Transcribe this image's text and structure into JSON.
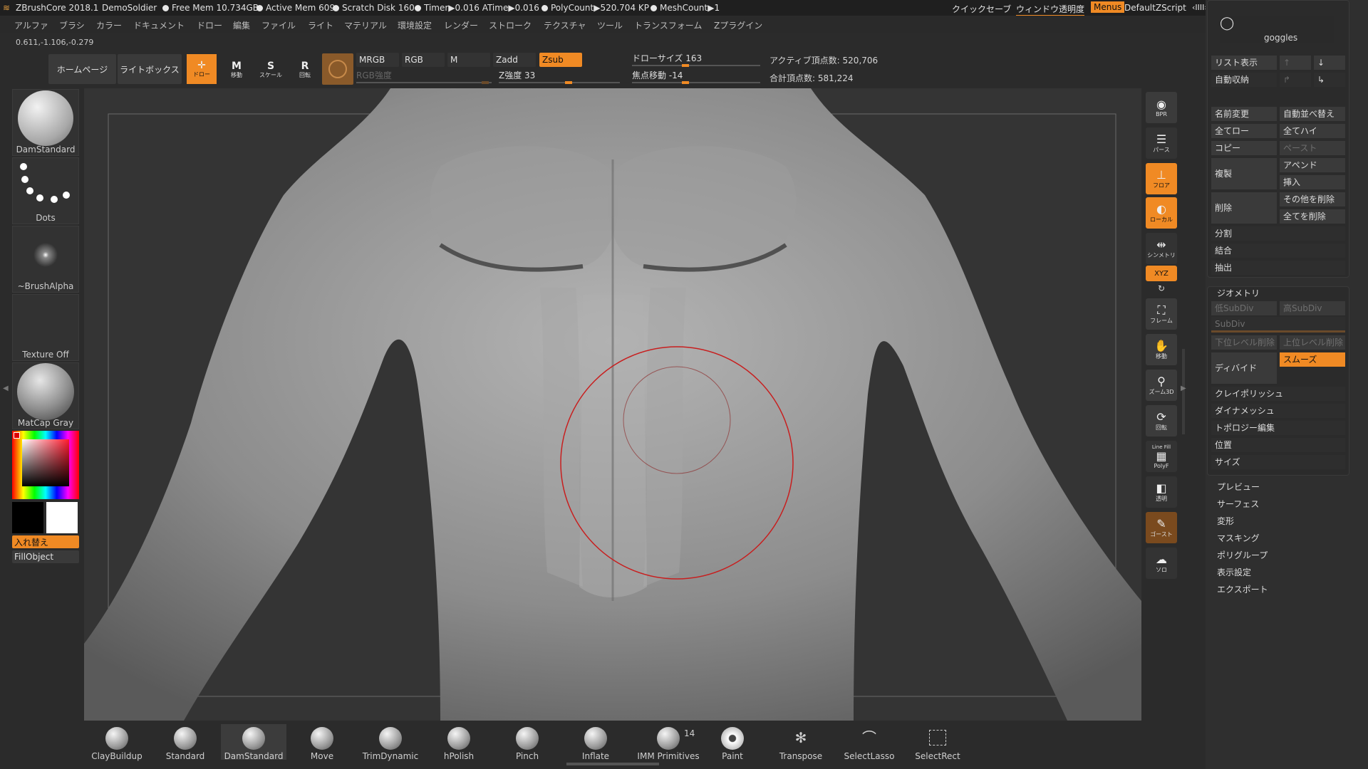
{
  "titlebar": {
    "app": "ZBrushCore 2018.1",
    "doc": "DemoSoldier",
    "free_mem": "Free Mem 10.734GB",
    "active_mem": "Active Mem 609",
    "scratch": "Scratch Disk 160",
    "timer": "Timer▶0.016 ATime▶0.016",
    "polycount": "PolyCount▶520.704 KP",
    "meshcount": "MeshCount▶1",
    "quicksave": "クイックセーブ",
    "transparency": "ウィンドウ透明度",
    "menus": "Menus",
    "script": "DefaultZScript"
  },
  "menu": [
    "アルファ",
    "ブラシ",
    "カラー",
    "ドキュメント",
    "ドロー",
    "編集",
    "ファイル",
    "ライト",
    "マテリアル",
    "環境設定",
    "レンダー",
    "ストローク",
    "テクスチャ",
    "ツール",
    "トランスフォーム",
    "Zプラグイン"
  ],
  "coords": "0.611,-1.106,-0.279",
  "shelf": {
    "home": "ホームページ",
    "lightbox": "ライトボックス",
    "draw": "ドロー",
    "move": "移動",
    "scale": "スケール",
    "rotate": "回転",
    "mrgb": "MRGB",
    "rgb": "RGB",
    "m": "M",
    "zadd": "Zadd",
    "zsub": "Zsub",
    "rgb_intensity": "RGB強度",
    "z_intensity": "Z強度 33",
    "draw_size": "ドローサイズ 163",
    "focal_shift": "焦点移動 -14",
    "active_points": "アクティブ頂点数: 520,706",
    "total_points": "合計頂点数: 581,224"
  },
  "left": {
    "brush": "DamStandard",
    "stroke": "Dots",
    "alpha": "~BrushAlpha",
    "texture": "Texture Off",
    "material": "MatCap Gray",
    "swap": "入れ替え",
    "fill": "FillObject"
  },
  "brushes": [
    {
      "label": "ClayBuildup"
    },
    {
      "label": "Standard"
    },
    {
      "label": "DamStandard"
    },
    {
      "label": "Move"
    },
    {
      "label": "TrimDynamic"
    },
    {
      "label": "hPolish"
    },
    {
      "label": "Pinch"
    },
    {
      "label": "Inflate"
    },
    {
      "label": "IMM Primitives",
      "badge": "14"
    },
    {
      "label": "Paint"
    },
    {
      "label": "Transpose"
    },
    {
      "label": "SelectLasso"
    },
    {
      "label": "SelectRect"
    }
  ],
  "rightshelf": {
    "bpr": "BPR",
    "persp": "パース",
    "floor": "フロア",
    "local": "ローカル",
    "sym": "シンメトリ",
    "xyz": "XYZ",
    "frame": "フレーム",
    "move": "移動",
    "zoom": "ズーム3D",
    "rotate": "回転",
    "linefill": "Line Fill",
    "polyf": "PolyF",
    "transp": "透明",
    "ghost": "ゴースト",
    "solo": "ソロ"
  },
  "tray": {
    "subtool": "goggles",
    "list": "リスト表示",
    "autocollapse": "自動収納",
    "rename": "名前変更",
    "autoreorder": "自動並べ替え",
    "all_low": "全てロー",
    "all_high": "全てハイ",
    "copy": "コピー",
    "paste": "ペースト",
    "duplicate": "複製",
    "append": "アペンド",
    "insert": "挿入",
    "delete": "削除",
    "del_other": "その他を削除",
    "del_all": "全てを削除",
    "split": "分割",
    "merge": "結合",
    "extract": "抽出",
    "geometry": "ジオメトリ",
    "low_subdiv": "低SubDiv",
    "high_subdiv": "高SubDiv",
    "subdiv": "SubDiv",
    "del_lower": "下位レベル削除",
    "del_higher": "上位レベル削除",
    "divide": "ディバイド",
    "smooth": "スムーズ",
    "claypolish": "クレイポリッシュ",
    "dynamesh": "ダイナメッシュ",
    "topology": "トポロジー編集",
    "position": "位置",
    "size": "サイズ",
    "sections": [
      "プレビュー",
      "サーフェス",
      "変形",
      "マスキング",
      "ポリグループ",
      "表示設定",
      "エクスポート"
    ]
  },
  "colors": {
    "accent": "#f08a24",
    "bg": "#2b2b2b",
    "cursor": "#c81e1e"
  }
}
